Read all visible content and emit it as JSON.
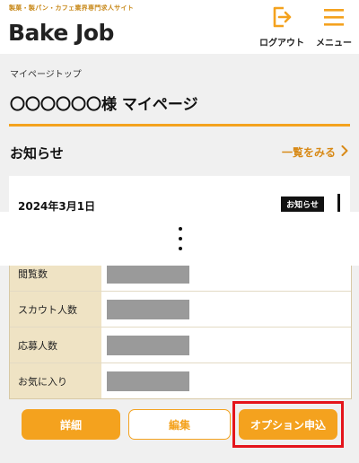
{
  "header": {
    "tagline": "製菓・製パン・カフェ業界専門求人サイト",
    "logo": "Bake Job",
    "logout_label": "ログアウト",
    "menu_label": "メニュー"
  },
  "breadcrumb": "マイページトップ",
  "page_title": "〇〇〇〇〇〇様 マイページ",
  "notices": {
    "title": "お知らせ",
    "see_all": "一覧をみる",
    "items": [
      {
        "date": "2024年3月1日",
        "badge": "お知らせ"
      }
    ]
  },
  "stats": [
    {
      "label": "閲覧数"
    },
    {
      "label": "スカウト人数"
    },
    {
      "label": "応募人数"
    },
    {
      "label": "お気に入り"
    }
  ],
  "actions": {
    "detail": "詳細",
    "edit": "編集",
    "option": "オプション申込"
  },
  "colors": {
    "accent": "#f4a21e",
    "highlight": "#e4141b",
    "label_bg": "#efe3c4"
  }
}
